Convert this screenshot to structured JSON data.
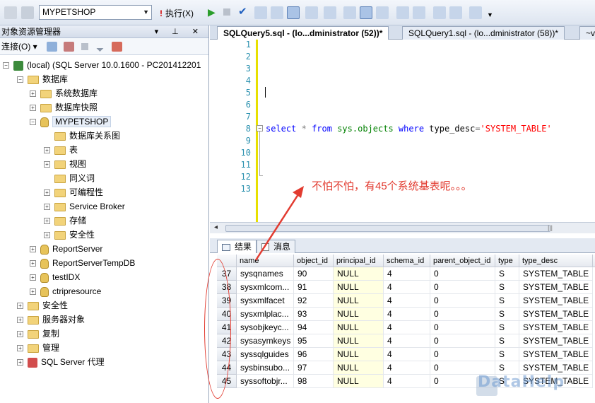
{
  "toolbar": {
    "database": "MYPETSHOP",
    "execute_label": "执行(X)"
  },
  "object_explorer": {
    "title": "对象资源管理器",
    "connect_label": "连接(O)",
    "nodes": [
      {
        "label": "(local) (SQL Server 10.0.1600 - PC201412201",
        "level": 0,
        "expanded": true,
        "icon": "server-icon"
      },
      {
        "label": "数据库",
        "level": 1,
        "expanded": true,
        "icon": "folder-icon"
      },
      {
        "label": "系统数据库",
        "level": 2,
        "expanded": false,
        "icon": "folder-icon"
      },
      {
        "label": "数据库快照",
        "level": 2,
        "expanded": false,
        "icon": "folder-icon"
      },
      {
        "label": "MYPETSHOP",
        "level": 2,
        "expanded": true,
        "icon": "database-icon",
        "selected": true
      },
      {
        "label": "数据库关系图",
        "level": 3,
        "expanded": null,
        "icon": "folder-icon"
      },
      {
        "label": "表",
        "level": 3,
        "expanded": false,
        "icon": "folder-icon"
      },
      {
        "label": "视图",
        "level": 3,
        "expanded": false,
        "icon": "folder-icon"
      },
      {
        "label": "同义词",
        "level": 3,
        "expanded": null,
        "icon": "folder-icon"
      },
      {
        "label": "可编程性",
        "level": 3,
        "expanded": false,
        "icon": "folder-icon"
      },
      {
        "label": "Service Broker",
        "level": 3,
        "expanded": false,
        "icon": "folder-icon"
      },
      {
        "label": "存储",
        "level": 3,
        "expanded": false,
        "icon": "folder-icon"
      },
      {
        "label": "安全性",
        "level": 3,
        "expanded": false,
        "icon": "folder-icon"
      },
      {
        "label": "ReportServer",
        "level": 2,
        "expanded": false,
        "icon": "database-icon"
      },
      {
        "label": "ReportServerTempDB",
        "level": 2,
        "expanded": false,
        "icon": "database-icon"
      },
      {
        "label": "testIDX",
        "level": 2,
        "expanded": false,
        "icon": "database-icon"
      },
      {
        "label": "ctripresource",
        "level": 2,
        "expanded": false,
        "icon": "database-icon"
      },
      {
        "label": "安全性",
        "level": 1,
        "expanded": false,
        "icon": "folder-icon"
      },
      {
        "label": "服务器对象",
        "level": 1,
        "expanded": false,
        "icon": "folder-icon"
      },
      {
        "label": "复制",
        "level": 1,
        "expanded": false,
        "icon": "folder-icon"
      },
      {
        "label": "管理",
        "level": 1,
        "expanded": false,
        "icon": "folder-icon"
      },
      {
        "label": "SQL Server 代理",
        "level": 1,
        "expanded": false,
        "icon": "agent-icon"
      }
    ]
  },
  "editor": {
    "tabs": [
      {
        "label": "SQLQuery5.sql - (lo...dministrator (52))*",
        "active": true
      },
      {
        "label": "SQLQuery1.sql - (lo...dministrator (58))*",
        "active": false
      },
      {
        "label": "~v",
        "active": false
      }
    ],
    "line_numbers": [
      "1",
      "2",
      "3",
      "4",
      "5",
      "6",
      "7",
      "8",
      "9",
      "10",
      "11",
      "12",
      "13"
    ],
    "code_line": {
      "kw_select": "select",
      "star": "*",
      "kw_from": "from",
      "obj": "sys.objects",
      "kw_where": "where",
      "col": "type_desc",
      "eq": "=",
      "str": "'SYSTEM_TABLE'"
    },
    "annotation": "不怕不怕，有45个系统基表呢。。。"
  },
  "results": {
    "tabs": [
      {
        "label": "结果",
        "active": true
      },
      {
        "label": "消息",
        "active": false
      }
    ],
    "columns": [
      "name",
      "object_id",
      "principal_id",
      "schema_id",
      "parent_object_id",
      "type",
      "type_desc",
      "c"
    ],
    "rows": [
      {
        "n": "37",
        "cells": [
          "sysqnames",
          "90",
          "NULL",
          "4",
          "0",
          "S",
          "SYSTEM_TABLE"
        ]
      },
      {
        "n": "38",
        "cells": [
          "sysxmlcom...",
          "91",
          "NULL",
          "4",
          "0",
          "S",
          "SYSTEM_TABLE"
        ]
      },
      {
        "n": "39",
        "cells": [
          "sysxmlfacet",
          "92",
          "NULL",
          "4",
          "0",
          "S",
          "SYSTEM_TABLE"
        ]
      },
      {
        "n": "40",
        "cells": [
          "sysxmlplac...",
          "93",
          "NULL",
          "4",
          "0",
          "S",
          "SYSTEM_TABLE"
        ]
      },
      {
        "n": "41",
        "cells": [
          "sysobjkeyc...",
          "94",
          "NULL",
          "4",
          "0",
          "S",
          "SYSTEM_TABLE"
        ]
      },
      {
        "n": "42",
        "cells": [
          "sysasymkeys",
          "95",
          "NULL",
          "4",
          "0",
          "S",
          "SYSTEM_TABLE"
        ]
      },
      {
        "n": "43",
        "cells": [
          "syssqlguides",
          "96",
          "NULL",
          "4",
          "0",
          "S",
          "SYSTEM_TABLE"
        ]
      },
      {
        "n": "44",
        "cells": [
          "sysbinsubo...",
          "97",
          "NULL",
          "4",
          "0",
          "S",
          "SYSTEM_TABLE"
        ]
      },
      {
        "n": "45",
        "cells": [
          "syssoftobjr...",
          "98",
          "NULL",
          "4",
          "0",
          "S",
          "SYSTEM_TABLE"
        ]
      }
    ]
  },
  "watermark": "DataHelp",
  "colors": {
    "annotation": "#e23b30",
    "keyword": "#0000ff",
    "object": "#008000",
    "string": "#ff0000",
    "null_cell": "#ffffe1"
  }
}
